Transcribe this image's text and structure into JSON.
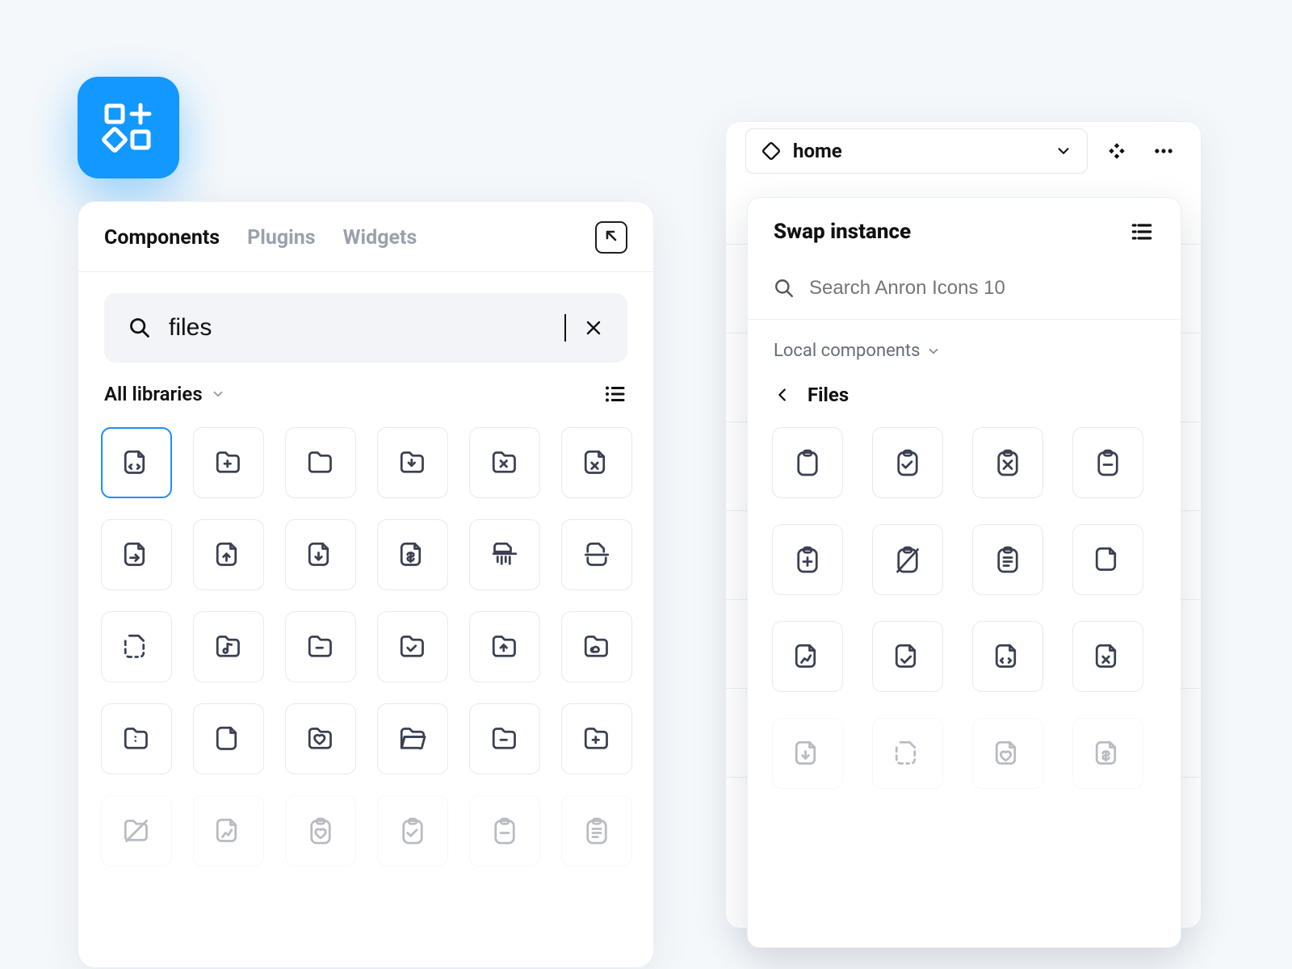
{
  "leftPanel": {
    "tabs": [
      "Components",
      "Plugins",
      "Widgets"
    ],
    "activeTab": 0,
    "search": {
      "value": "files"
    },
    "filterLabel": "All libraries",
    "icons": [
      {
        "n": "file-code-icon",
        "sel": true
      },
      {
        "n": "folder-plus-icon"
      },
      {
        "n": "folder-icon"
      },
      {
        "n": "folder-download-icon"
      },
      {
        "n": "folder-x-icon"
      },
      {
        "n": "file-x-icon"
      },
      {
        "n": "file-arrow-right-icon"
      },
      {
        "n": "file-upload-icon"
      },
      {
        "n": "file-download-icon"
      },
      {
        "n": "file-dollar-icon"
      },
      {
        "n": "file-shred-icon"
      },
      {
        "n": "file-split-icon"
      },
      {
        "n": "file-dashed-icon"
      },
      {
        "n": "folder-music-icon"
      },
      {
        "n": "folder-minus-icon"
      },
      {
        "n": "folder-check-icon"
      },
      {
        "n": "folder-upload-icon"
      },
      {
        "n": "folder-cloud-icon"
      },
      {
        "n": "folder-options-icon"
      },
      {
        "n": "file-blank-icon"
      },
      {
        "n": "folder-heart-icon"
      },
      {
        "n": "folder-open-icon"
      },
      {
        "n": "folder-remove-icon"
      },
      {
        "n": "folder-add-icon"
      },
      {
        "n": "folder-slash-icon",
        "faded": true
      },
      {
        "n": "file-chart-icon",
        "faded": true
      },
      {
        "n": "clipboard-heart-icon",
        "faded": true
      },
      {
        "n": "clipboard-check-icon",
        "faded": true
      },
      {
        "n": "clipboard-minus-icon",
        "faded": true
      },
      {
        "n": "clipboard-list-icon",
        "faded": true
      }
    ]
  },
  "rightPanel": {
    "instanceName": "home",
    "swapTitle": "Swap instance",
    "searchPlaceholder": "Search Anron Icons 10",
    "libLabel": "Local components",
    "breadcrumb": "Files",
    "icons": [
      {
        "n": "clipboard-icon"
      },
      {
        "n": "clipboard-check-icon"
      },
      {
        "n": "clipboard-x-icon"
      },
      {
        "n": "clipboard-minus-icon"
      },
      {
        "n": "clipboard-plus-icon"
      },
      {
        "n": "clipboard-slash-icon"
      },
      {
        "n": "clipboard-list-icon"
      },
      {
        "n": "file-blank-icon"
      },
      {
        "n": "file-chart-icon"
      },
      {
        "n": "file-check-icon"
      },
      {
        "n": "file-code-icon"
      },
      {
        "n": "file-x-icon"
      },
      {
        "n": "file-download-icon",
        "faded": true
      },
      {
        "n": "file-dashed-icon",
        "faded": true
      },
      {
        "n": "file-heart-icon",
        "faded": true
      },
      {
        "n": "file-dollar-icon",
        "faded": true
      }
    ]
  },
  "colors": {
    "accent": "#1298ff"
  }
}
